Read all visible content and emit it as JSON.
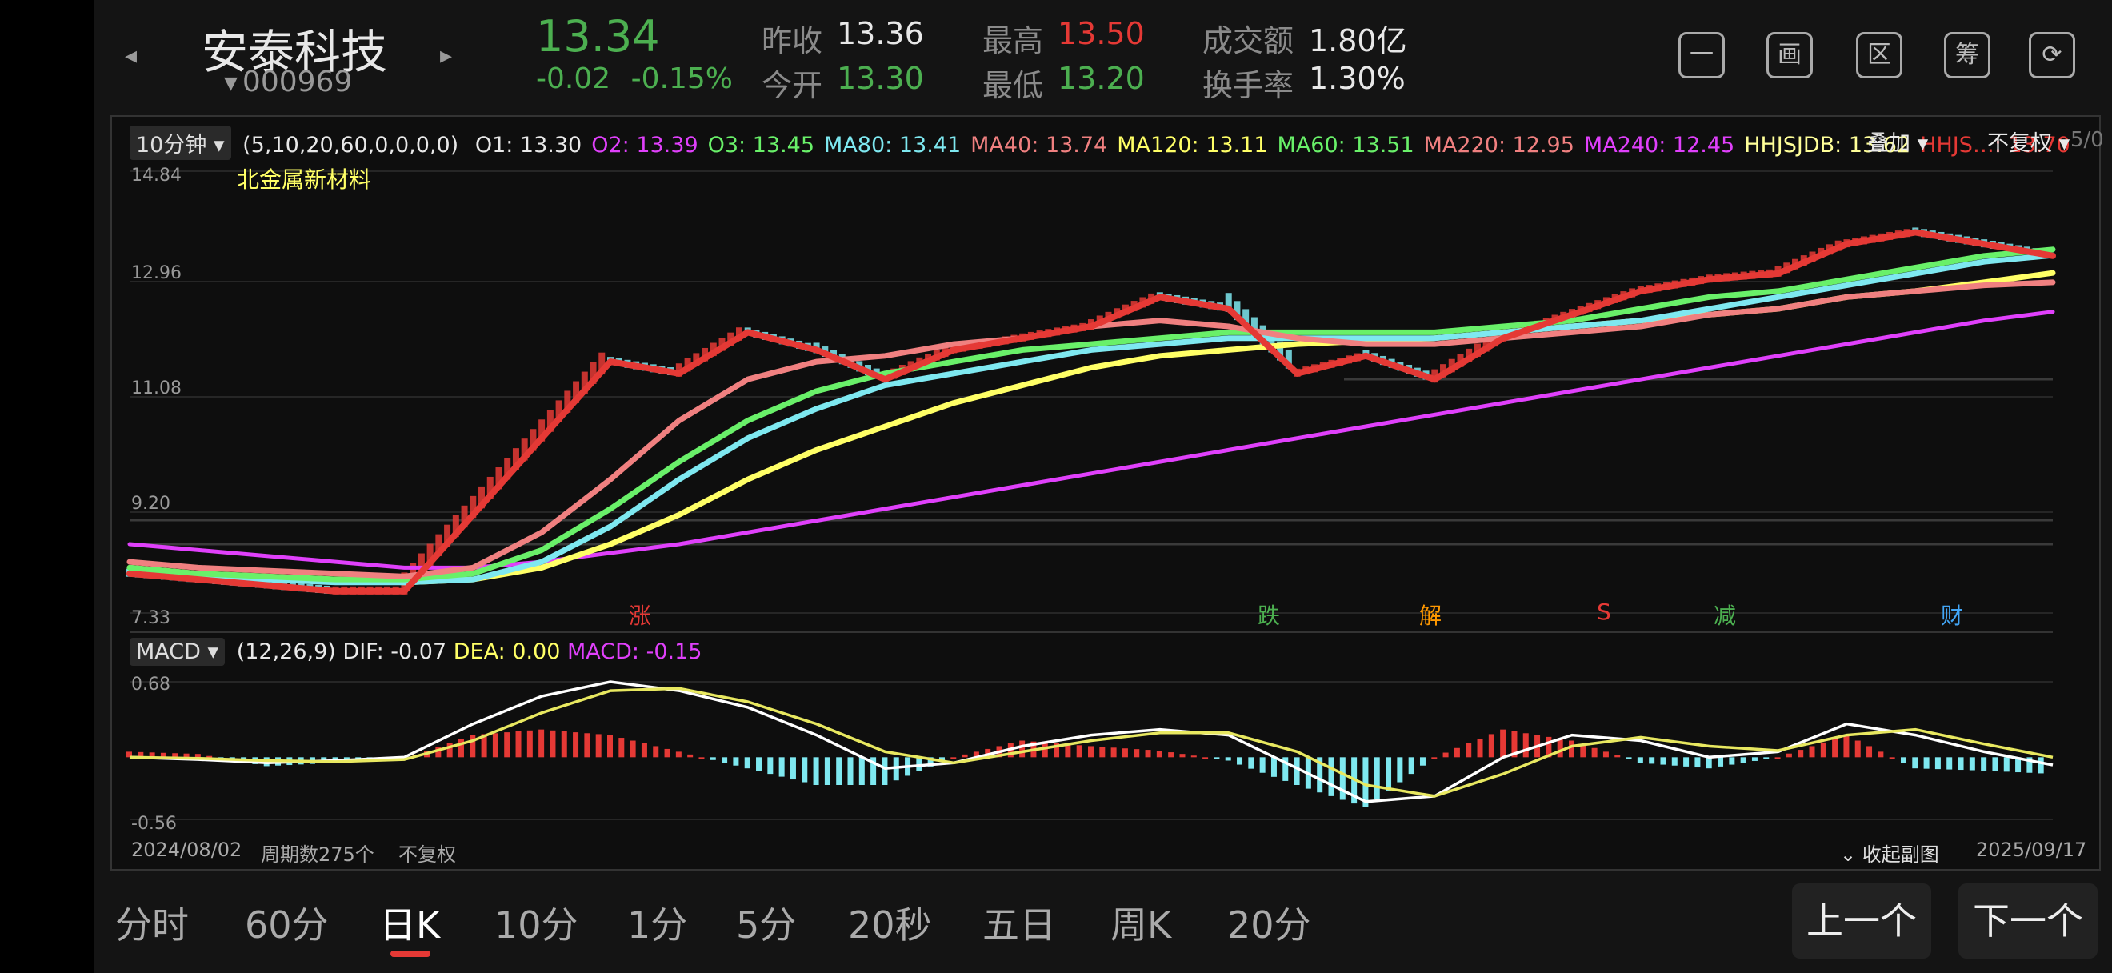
{
  "header": {
    "stock_name": "安泰科技",
    "stock_code": "000969",
    "price": "13.34",
    "change": "-0.02",
    "change_pct": "-0.15%",
    "stats": [
      {
        "label": "昨收",
        "value": "13.36",
        "color": "#e8e8e8"
      },
      {
        "label": "今开",
        "value": "13.30",
        "color": "#4caf50"
      },
      {
        "label": "最高",
        "value": "13.50",
        "color": "#e53935"
      },
      {
        "label": "最低",
        "value": "13.20",
        "color": "#4caf50"
      },
      {
        "label": "成交额",
        "value": "1.80亿",
        "color": "#e8e8e8"
      },
      {
        "label": "换手率",
        "value": "1.30%",
        "color": "#e8e8e8"
      }
    ],
    "tools": [
      {
        "name": "minimize-icon",
        "glyph": "一"
      },
      {
        "name": "draw-icon",
        "glyph": "画"
      },
      {
        "name": "range-icon",
        "glyph": "区"
      },
      {
        "name": "chips-icon",
        "glyph": "筹"
      },
      {
        "name": "rotate-screen-icon",
        "glyph": "⟳"
      }
    ]
  },
  "main_panel": {
    "period_dropdown": "10分钟",
    "params": "(5,10,20,60,0,0,0,0)",
    "overlay_label": "叠加",
    "adjust_label": "不复权",
    "truncated_tail": "5/0",
    "sector_label": "北金属新材料",
    "indicators": [
      {
        "text": "O1: 13.30",
        "color": "#e8e8e8"
      },
      {
        "text": "O2: 13.39",
        "color": "#e040fb"
      },
      {
        "text": "O3: 13.45",
        "color": "#69f069"
      },
      {
        "text": "MA80: 13.41",
        "color": "#7ee8f0"
      },
      {
        "text": "MA40: 13.74",
        "color": "#f08080"
      },
      {
        "text": "MA120: 13.11",
        "color": "#ffff66"
      },
      {
        "text": "MA60: 13.51",
        "color": "#69f069"
      },
      {
        "text": "MA220: 12.95",
        "color": "#f08080"
      },
      {
        "text": "MA240: 12.45",
        "color": "#e040fb"
      },
      {
        "text": "HHJSJDB: 13.62",
        "color": "#ffff99"
      },
      {
        "text": "HHJS…: 13.70",
        "color": "#e53935"
      }
    ],
    "y_labels": [
      "14.84",
      "12.96",
      "11.08",
      "9.20",
      "7.33"
    ],
    "events": [
      {
        "text": "涨",
        "color": "#e53935"
      },
      {
        "text": "跌",
        "color": "#4caf50"
      },
      {
        "text": "解",
        "color": "#ff9800"
      },
      {
        "text": "S",
        "color": "#e53935"
      },
      {
        "text": "减",
        "color": "#4caf50"
      },
      {
        "text": "财",
        "color": "#42a5f5"
      }
    ]
  },
  "macd_panel": {
    "dropdown": "MACD",
    "params": "(12,26,9)",
    "dif": "DIF: -0.07",
    "dea": "DEA: 0.00",
    "macd": "MACD: -0.15",
    "y_top": "0.68",
    "y_bottom": "-0.56"
  },
  "footer": {
    "start_date": "2024/08/02",
    "period_count": "周期数275个",
    "adjust": "不复权",
    "collapse": "收起副图",
    "end_date": "2025/09/17"
  },
  "tabs": [
    {
      "label": "分时",
      "active": false
    },
    {
      "label": "60分",
      "active": false
    },
    {
      "label": "日K",
      "active": true
    },
    {
      "label": "10分",
      "active": false
    },
    {
      "label": "1分",
      "active": false
    },
    {
      "label": "5分",
      "active": false
    },
    {
      "label": "20秒",
      "active": false
    },
    {
      "label": "五日",
      "active": false
    },
    {
      "label": "周K",
      "active": false
    },
    {
      "label": "20分",
      "active": false
    }
  ],
  "nav": {
    "prev": "上一个",
    "next": "下一个"
  },
  "chart_data": {
    "type": "line",
    "ylim": [
      7.33,
      14.84
    ],
    "x_range": [
      "2024/08/02",
      "2025/09/17"
    ],
    "series": [
      {
        "name": "HHJS",
        "color": "#e53935",
        "values": [
          8.0,
          7.9,
          7.8,
          7.7,
          7.7,
          9.0,
          10.3,
          11.6,
          11.4,
          12.1,
          11.8,
          11.3,
          11.8,
          12.0,
          12.2,
          12.7,
          12.5,
          11.4,
          11.7,
          11.3,
          12.0,
          12.4,
          12.8,
          13.0,
          13.1,
          13.6,
          13.8,
          13.6,
          13.4
        ]
      },
      {
        "name": "MA40",
        "color": "#f08080",
        "values": [
          8.2,
          8.1,
          8.05,
          8.0,
          7.95,
          8.1,
          8.7,
          9.6,
          10.6,
          11.3,
          11.6,
          11.7,
          11.9,
          12.0,
          12.2,
          12.3,
          12.2,
          12.0,
          11.9,
          11.9,
          12.0,
          12.1,
          12.2,
          12.4,
          12.5,
          12.7,
          12.8,
          12.9,
          12.95
        ]
      },
      {
        "name": "MA60",
        "color": "#69f069",
        "values": [
          8.1,
          8.0,
          7.95,
          7.9,
          7.9,
          8.0,
          8.4,
          9.1,
          9.9,
          10.6,
          11.1,
          11.4,
          11.6,
          11.8,
          11.9,
          12.0,
          12.1,
          12.1,
          12.1,
          12.1,
          12.2,
          12.3,
          12.5,
          12.7,
          12.8,
          13.0,
          13.2,
          13.4,
          13.51
        ]
      },
      {
        "name": "MA80",
        "color": "#7ee8f0",
        "values": [
          8.05,
          7.95,
          7.9,
          7.85,
          7.85,
          7.9,
          8.2,
          8.8,
          9.6,
          10.3,
          10.8,
          11.2,
          11.4,
          11.6,
          11.8,
          11.9,
          12.0,
          12.0,
          12.0,
          12.0,
          12.1,
          12.2,
          12.3,
          12.5,
          12.7,
          12.9,
          13.1,
          13.3,
          13.41
        ]
      },
      {
        "name": "MA120",
        "color": "#ffff66",
        "values": [
          8.1,
          8.0,
          7.95,
          7.9,
          7.85,
          7.9,
          8.1,
          8.5,
          9.0,
          9.6,
          10.1,
          10.5,
          10.9,
          11.2,
          11.5,
          11.7,
          11.8,
          11.9,
          11.95,
          12.0,
          12.1,
          12.2,
          12.3,
          12.4,
          12.5,
          12.7,
          12.8,
          12.95,
          13.11
        ]
      },
      {
        "name": "MA240",
        "color": "#e040fb",
        "values": [
          8.5,
          8.4,
          8.3,
          8.2,
          8.1,
          8.1,
          8.2,
          8.35,
          8.5,
          8.7,
          8.9,
          9.1,
          9.3,
          9.5,
          9.7,
          9.9,
          10.1,
          10.3,
          10.5,
          10.7,
          10.9,
          11.1,
          11.3,
          11.5,
          11.7,
          11.9,
          12.1,
          12.3,
          12.45
        ]
      }
    ],
    "macd_ylim": [
      -0.56,
      0.68
    ],
    "macd_dif": [
      0.0,
      -0.02,
      -0.05,
      -0.03,
      0.0,
      0.3,
      0.55,
      0.68,
      0.6,
      0.45,
      0.2,
      -0.1,
      -0.05,
      0.1,
      0.2,
      0.25,
      0.2,
      -0.1,
      -0.4,
      -0.35,
      0.0,
      0.2,
      0.15,
      0.0,
      0.05,
      0.3,
      0.2,
      0.05,
      -0.07
    ],
    "macd_dea": [
      0.0,
      -0.01,
      -0.03,
      -0.04,
      -0.02,
      0.15,
      0.4,
      0.6,
      0.62,
      0.5,
      0.3,
      0.05,
      -0.05,
      0.05,
      0.15,
      0.22,
      0.22,
      0.05,
      -0.25,
      -0.35,
      -0.15,
      0.1,
      0.18,
      0.1,
      0.06,
      0.2,
      0.25,
      0.12,
      0.0
    ],
    "macd_hist": [
      0.05,
      0.03,
      -0.08,
      -0.05,
      -0.02,
      0.2,
      0.25,
      0.2,
      0.05,
      -0.1,
      -0.25,
      -0.25,
      0.0,
      0.15,
      0.1,
      0.06,
      -0.03,
      -0.25,
      -0.45,
      0.0,
      0.25,
      0.15,
      -0.05,
      -0.1,
      0.0,
      0.2,
      -0.1,
      -0.12,
      -0.15
    ]
  }
}
